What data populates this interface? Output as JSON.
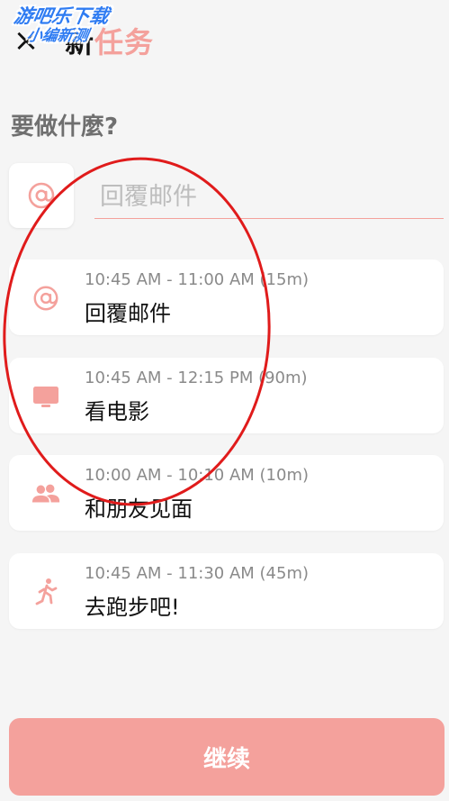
{
  "header": {
    "close_glyph": "×",
    "title_part1": "新",
    "title_part2": "任务"
  },
  "watermark": {
    "line1": "游吧乐下载",
    "line2": "小编新测"
  },
  "form": {
    "question": "要做什麼?",
    "input_placeholder": "回覆邮件",
    "selected_icon": "at-sign-icon"
  },
  "suggestions": [
    {
      "time": "10:45 AM - 11:00 AM (15m)",
      "name": "回覆邮件",
      "icon": "at-sign-icon"
    },
    {
      "time": "10:45 AM - 12:15 PM (90m)",
      "name": "看电影",
      "icon": "tv-icon"
    },
    {
      "time": "10:00 AM - 10:10 AM (10m)",
      "name": "和朋友见面",
      "icon": "people-icon"
    },
    {
      "time": "10:45 AM - 11:30 AM (45m)",
      "name": "去跑步吧!",
      "icon": "running-icon"
    }
  ],
  "footer": {
    "continue_label": "继续"
  },
  "colors": {
    "accent": "#f4a19c",
    "background": "#f5f5f5",
    "card": "#ffffff",
    "annotation": "#e01b1b"
  }
}
